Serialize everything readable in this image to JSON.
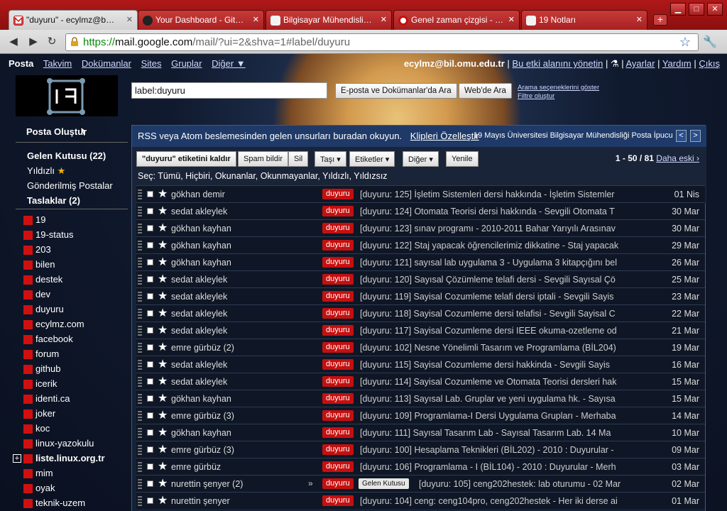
{
  "browser": {
    "tabs": [
      {
        "title": "\"duyuru\" - ecylmz@b…",
        "icon": "gmail-icon",
        "color": "#c41010"
      },
      {
        "title": "Your Dashboard - Git…",
        "icon": "github-icon",
        "color": "#222222"
      },
      {
        "title": "Bilgisayar Mühendisli…",
        "icon": "page-icon",
        "color": "#f2f2f2"
      },
      {
        "title": "Genel zaman çizgisi - …",
        "icon": "identica-icon",
        "color": "#c41010"
      },
      {
        "title": "19 Notları",
        "icon": "page-icon",
        "color": "#f2f2f2"
      }
    ],
    "url_scheme": "https://",
    "url_host": "mail.google.com",
    "url_path": "/mail/?ui=2&shva=1#label/duyuru"
  },
  "topnav": {
    "items": [
      "Posta",
      "Takvim",
      "Dokümanlar",
      "Sites",
      "Gruplar",
      "Diğer ▼"
    ],
    "account": "ecylmz@bil.omu.edu.tr",
    "manage": "Bu etki alanını yönetin",
    "settings": "Ayarlar",
    "help": "Yardım",
    "logout": "Çıkış"
  },
  "search": {
    "value": "label:duyuru",
    "btn_mail": "E-posta ve Dokümanlar'da Ara",
    "btn_web": "Web'de Ara",
    "link_options": "Arama seçeneklerini göster",
    "link_filter": "Filtre oluştur"
  },
  "sidebar": {
    "compose": "Posta Oluştur",
    "inbox": "Gelen Kutusu (22)",
    "starred": "Yıldızlı",
    "sent": "Gönderilmiş Postalar",
    "drafts": "Taslaklar (2)",
    "labels": [
      "19",
      "19-status",
      "203",
      "bilen",
      "destek",
      "dev",
      "duyuru",
      "ecylmz.com",
      "facebook",
      "forum",
      "github",
      "icerik",
      "identi.ca",
      "joker",
      "koc",
      "linux-yazokulu",
      "liste.linux.org.tr",
      "mim",
      "oyak",
      "teknik-uzem"
    ]
  },
  "rss": {
    "text": "RSS veya Atom beslemesinden gelen unsurları buradan okuyun.",
    "link": "Klipleri Özelleştir",
    "tip": "19 Mayıs Üniversitesi Bilgisayar Mühendisliği Posta İpucu"
  },
  "actions": {
    "remove_label": "\"duyuru\" etiketini kaldır",
    "spam": "Spam bildir",
    "delete": "Sil",
    "move": "Taşı ▾",
    "labels": "Etiketler ▾",
    "more": "Diğer ▾",
    "refresh": "Yenile",
    "range": "1 - 50 / 81",
    "older": "Daha eski ›",
    "select": "Seç: Tümü, Hiçbiri, Okunanlar, Okunmayanlar, Yıldızlı, Yıldızsız"
  },
  "messages": [
    {
      "from": "gökhan demir",
      "tag": "duyuru",
      "subject": "[duyuru: 125] İşletim Sistemleri dersi hakkında - İşletim Sistemler",
      "date": "01 Nis"
    },
    {
      "from": "sedat akleylek",
      "tag": "duyuru",
      "subject": "[duyuru: 124] Otomata Teorisi dersi hakkında - Sevgili Otomata T",
      "date": "30 Mar"
    },
    {
      "from": "gökhan kayhan",
      "tag": "duyuru",
      "subject": "[duyuru: 123] sınav programı - 2010-2011 Bahar Yarıyılı Arasınav",
      "date": "30 Mar"
    },
    {
      "from": "gökhan kayhan",
      "tag": "duyuru",
      "subject": "[duyuru: 122] Staj yapacak öğrencilerimiz dikkatine - Staj yapacak",
      "date": "29 Mar"
    },
    {
      "from": "gökhan kayhan",
      "tag": "duyuru",
      "subject": "[duyuru: 121] sayısal lab uygulama 3 - Uygulama 3 kitapçığını bel",
      "date": "26 Mar"
    },
    {
      "from": "sedat akleylek",
      "tag": "duyuru",
      "subject": "[duyuru: 120] Sayısal Çözümleme telafi dersi - Sevgili Sayısal Çö",
      "date": "25 Mar"
    },
    {
      "from": "sedat akleylek",
      "tag": "duyuru",
      "subject": "[duyuru: 119] Sayisal Cozumleme telafi dersi iptali - Sevgili Sayis",
      "date": "23 Mar"
    },
    {
      "from": "sedat akleylek",
      "tag": "duyuru",
      "subject": "[duyuru: 118] Sayisal Cozumleme dersi telafisi - Sevgili Sayisal C",
      "date": "22 Mar"
    },
    {
      "from": "sedat akleylek",
      "tag": "duyuru",
      "subject": "[duyuru: 117] Sayisal Cozumleme dersi IEEE okuma-ozetleme od",
      "date": "21 Mar"
    },
    {
      "from": "emre gürbüz (2)",
      "tag": "duyuru",
      "subject": "[duyuru: 102] Nesne Yönelimli Tasarım ve Programlama (BİL204)",
      "date": "19 Mar"
    },
    {
      "from": "sedat akleylek",
      "tag": "duyuru",
      "subject": "[duyuru: 115] Sayisal Cozumleme dersi hakkinda - Sevgili Sayis",
      "date": "16 Mar"
    },
    {
      "from": "sedat akleylek",
      "tag": "duyuru",
      "subject": "[duyuru: 114] Sayisal Cozumleme ve Otomata Teorisi dersleri hak",
      "date": "15 Mar"
    },
    {
      "from": "gökhan kayhan",
      "tag": "duyuru",
      "subject": "[duyuru: 113] Sayısal Lab. Gruplar ve yeni uygulama hk. - Sayısa",
      "date": "15 Mar"
    },
    {
      "from": "emre gürbüz (3)",
      "tag": "duyuru",
      "subject": "[duyuru: 109] Programlama-I Dersi Uygulama Grupları - Merhaba",
      "date": "14 Mar"
    },
    {
      "from": "gökhan kayhan",
      "tag": "duyuru",
      "subject": "[duyuru: 111] Sayısal Tasarım Lab - Sayısal Tasarım Lab. 14 Ma",
      "date": "10 Mar"
    },
    {
      "from": "emre gürbüz (3)",
      "tag": "duyuru",
      "subject": "[duyuru: 100] Hesaplama Teknikleri (BİL202) - 2010 : Duyurular -",
      "date": "09 Mar"
    },
    {
      "from": "emre gürbüz",
      "tag": "duyuru",
      "subject": "[duyuru: 106] Programlama - I (BİL104) - 2010 : Duyurular - Merh",
      "date": "03 Mar"
    },
    {
      "from": "nurettin şenyer (2)",
      "tag": "duyuru",
      "tag2": "Gelen Kutusu",
      "subject": "[duyuru: 105] ceng202hestek: lab oturumu - 02 Mar",
      "date": "02 Mar"
    },
    {
      "from": "nurettin şenyer",
      "tag": "duyuru",
      "subject": "[duyuru: 104] ceng: ceng104pro, ceng202hestek - Her iki derse ai",
      "date": "01 Mar"
    }
  ]
}
